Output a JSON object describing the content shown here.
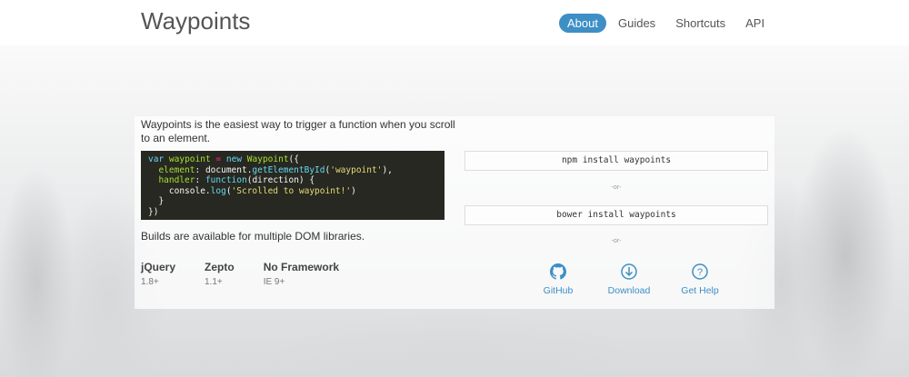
{
  "header": {
    "title": "Waypoints",
    "nav": [
      "About",
      "Guides",
      "Shortcuts",
      "API"
    ]
  },
  "intro": "Waypoints is the easiest way to trigger a function when you scroll to an element.",
  "builds": "Builds are available for multiple DOM libraries.",
  "libraries": [
    {
      "name": "jQuery",
      "version": "1.8+"
    },
    {
      "name": "Zepto",
      "version": "1.1+"
    },
    {
      "name": "No Framework",
      "version": "IE 9+"
    }
  ],
  "install": {
    "npm": "npm install waypoints",
    "bower": "bower install waypoints",
    "or": "-or-"
  },
  "links": [
    {
      "label": "GitHub",
      "icon": "github-icon"
    },
    {
      "label": "Download",
      "icon": "download-icon"
    },
    {
      "label": "Get Help",
      "icon": "help-icon"
    }
  ],
  "colors": {
    "accent": "#3d8fc6",
    "code_bg": "#272822"
  }
}
